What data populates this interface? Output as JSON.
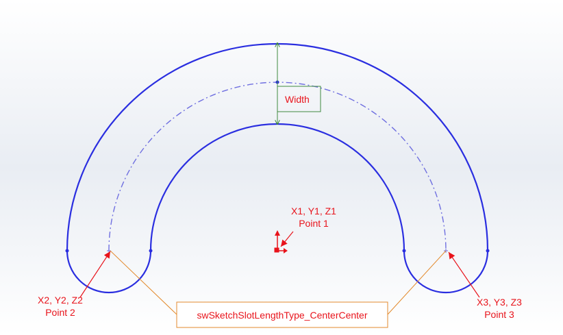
{
  "colors": {
    "background_top": "#ffffff",
    "background_mid": "#e9edf3",
    "background_bottom": "#ffffff",
    "slot_outline": "#2a2ee0",
    "centerline": "#6f6fe0",
    "dimension": "#3f8a3f",
    "callout_red": "#e8131b",
    "callout_orange": "#e38a2d",
    "origin_red": "#e8131b"
  },
  "labels": {
    "width": "Width",
    "point1_coords": "X1, Y1, Z1",
    "point1_name": "Point 1",
    "point2_coords": "X2, Y2, Z2",
    "point2_name": "Point 2",
    "point3_coords": "X3, Y3, Z3",
    "point3_name": "Point 3",
    "slot_type": "swSketchSlotLengthType_CenterCenter"
  }
}
